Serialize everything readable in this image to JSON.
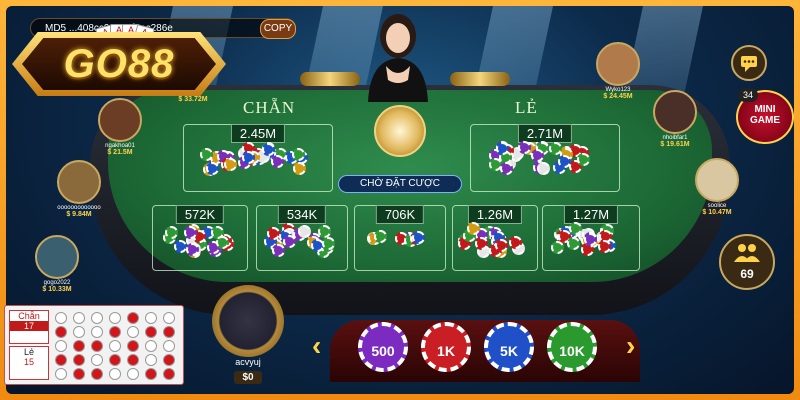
{
  "session_id": "MD5 ...408cc93394feec286e",
  "copy_label": "COPY",
  "logo_text": "GO88",
  "logo_cards": [
    "A",
    "A",
    "A",
    "A"
  ],
  "table": {
    "left_label": "CHẴN",
    "right_label": "LẺ",
    "status": "CHỜ ĐẶT CƯỢC",
    "big_bets": [
      {
        "label": "2.45M"
      },
      {
        "label": "2.71M"
      }
    ],
    "small_bets": [
      {
        "label": "572K"
      },
      {
        "label": "534K"
      },
      {
        "label": "706K"
      },
      {
        "label": "1.26M"
      },
      {
        "label": "1.27M"
      }
    ],
    "chip_colors": [
      "#c21a1a",
      "#1d53c4",
      "#2e9a36",
      "#7a2fb8",
      "#e6e6e6",
      "#d49a12"
    ]
  },
  "players_left": [
    {
      "name": "",
      "balance": "$ 33.72M"
    },
    {
      "name": "ngakhoa01",
      "balance": "$ 21.5M"
    },
    {
      "name": "ooooooooooooo",
      "balance": "$ 9.84M"
    },
    {
      "name": "gogo2022",
      "balance": "$ 10.33M"
    }
  ],
  "players_right": [
    {
      "name": "Wyko123",
      "balance": "$ 24.45M"
    },
    {
      "name": "nhoibfar1",
      "balance": "$ 19.61M"
    },
    {
      "name": "soolice",
      "balance": "$ 10.47M"
    }
  ],
  "mini_game": {
    "label_line1": "MINI",
    "label_line2": "GAME",
    "count": "34"
  },
  "online_count": "69",
  "roadmap": {
    "even_label": "Chẵn",
    "even_count": "17",
    "odd_label": "Lẻ",
    "odd_count": "15",
    "grid": [
      [
        "w",
        "w",
        "w",
        "w",
        "r",
        "w",
        "w"
      ],
      [
        "r",
        "w",
        "w",
        "r",
        "w",
        "r",
        "r"
      ],
      [
        "w",
        "r",
        "r",
        "w",
        "r",
        "w",
        "w"
      ],
      [
        "r",
        "r",
        "w",
        "r",
        "r",
        "w",
        "r"
      ],
      [
        "w",
        "r",
        "r",
        "w",
        "w",
        "r",
        "r"
      ]
    ]
  },
  "me": {
    "name": "acvyuj",
    "balance": "$0"
  },
  "chips": [
    {
      "label": "500",
      "color": "#7b2bbf"
    },
    {
      "label": "1K",
      "color": "#c81e24"
    },
    {
      "label": "5K",
      "color": "#2050c8"
    },
    {
      "label": "10K",
      "color": "#2b9a2e"
    }
  ]
}
